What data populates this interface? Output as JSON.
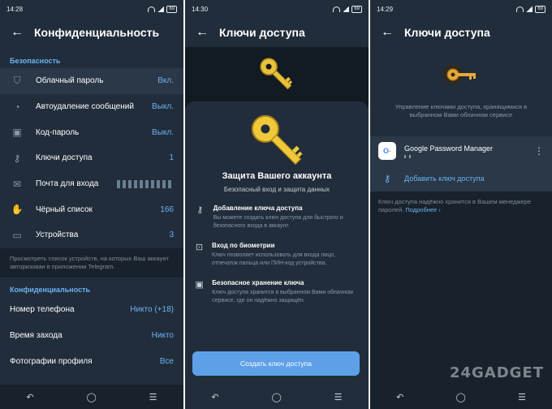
{
  "colors": {
    "bg": "#212d3b",
    "accent": "#6ab3f3",
    "button": "#5ea0e8",
    "key": "#e8c23a"
  },
  "p1": {
    "time": "14:28",
    "battery": "69",
    "title": "Конфиденциальность",
    "security_head": "Безопасность",
    "rows": [
      {
        "label": "Облачный пароль",
        "value": "Вкл.",
        "icon": "shield-check-icon"
      },
      {
        "label": "Автоудаление сообщений",
        "value": "Выкл.",
        "icon": "timer-icon"
      },
      {
        "label": "Код-пароль",
        "value": "Выкл.",
        "icon": "lock-icon"
      },
      {
        "label": "Ключи доступа",
        "value": "1",
        "icon": "key-icon"
      },
      {
        "label": "Почта для входа",
        "value": "",
        "icon": "mail-icon"
      },
      {
        "label": "Чёрный список",
        "value": "166",
        "icon": "hand-icon"
      },
      {
        "label": "Устройства",
        "value": "3",
        "icon": "devices-icon"
      }
    ],
    "note": "Просмотреть список устройств, на которых Ваш аккаунт авторизован в приложении Telegram.",
    "privacy_head": "Конфиденциальность",
    "privacy_rows": [
      {
        "label": "Номер телефона",
        "value": "Никто (+18)"
      },
      {
        "label": "Время захода",
        "value": "Никто"
      },
      {
        "label": "Фотографии профиля",
        "value": "Все"
      }
    ]
  },
  "p2": {
    "time": "14:30",
    "battery": "69",
    "title": "Ключи доступа",
    "sheet_title": "Защита Вашего аккаунта",
    "sheet_sub": "Безопасный вход и защита данных",
    "features": [
      {
        "icon": "key-icon",
        "title": "Добавление ключа доступа",
        "desc": "Вы можете создать ключ доступа для быстрого и безопасного входа в аккаунт."
      },
      {
        "icon": "face-scan-icon",
        "title": "Вход по биометрии",
        "desc": "Ключ позволяет использовать для входа лицо, отпечаток пальца или ПИН-код устройства."
      },
      {
        "icon": "lock-icon",
        "title": "Безопасное хранение ключа",
        "desc": "Ключ доступа хранится в выбранном Вами облачном сервисе, где он надёжно защищён."
      }
    ],
    "cta": "Создать ключ доступа"
  },
  "p3": {
    "time": "14:29",
    "battery": "69",
    "title": "Ключи доступа",
    "desc": "Управление ключами доступа, хранящимися в выбранном Вами облачном сервисе",
    "provider": "Google Password Manager",
    "add": "Добавить ключ доступа",
    "info": "Ключ доступа надёжно хранится в Вашем менеджере паролей.",
    "more": "Подробнее ›"
  },
  "nav": {
    "back": "↶",
    "home": "◯",
    "recents": "☰"
  },
  "watermark": "24GADGET"
}
